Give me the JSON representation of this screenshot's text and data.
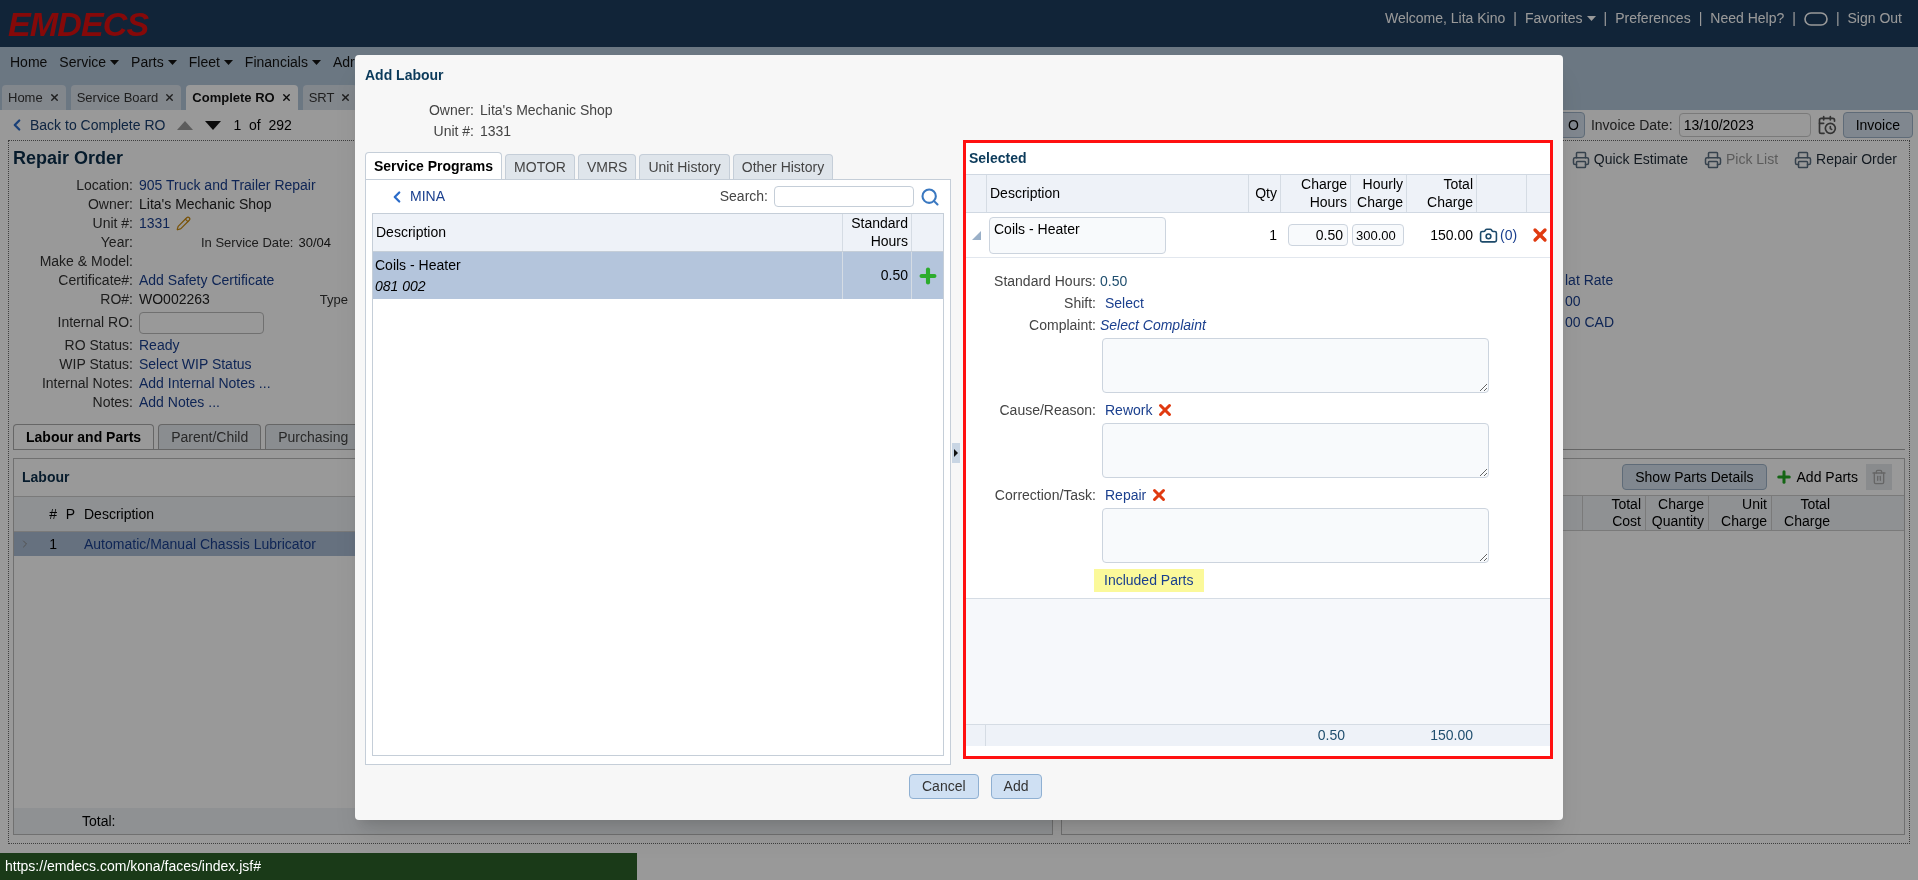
{
  "header": {
    "logo": "EMDECS",
    "items": [
      {
        "kind": "text",
        "label": "Welcome, Lita Kino"
      },
      {
        "kind": "sep",
        "label": "|"
      },
      {
        "kind": "menu",
        "label": "Favorites"
      },
      {
        "kind": "sep",
        "label": "|"
      },
      {
        "kind": "link",
        "label": "Preferences"
      },
      {
        "kind": "sep",
        "label": "|"
      },
      {
        "kind": "link",
        "label": "Need Help?"
      },
      {
        "kind": "sep",
        "label": "|"
      },
      {
        "kind": "chat"
      },
      {
        "kind": "sep",
        "label": "|"
      },
      {
        "kind": "link",
        "label": "Sign Out"
      }
    ]
  },
  "nav": [
    {
      "label": "Home",
      "dropdown": false
    },
    {
      "label": "Service",
      "dropdown": true
    },
    {
      "label": "Parts",
      "dropdown": true
    },
    {
      "label": "Fleet",
      "dropdown": true
    },
    {
      "label": "Financials",
      "dropdown": true
    },
    {
      "label": "Adr",
      "dropdown": false
    }
  ],
  "tabs": [
    {
      "label": "Home",
      "selected": false
    },
    {
      "label": "Service Board",
      "selected": false
    },
    {
      "label": "Complete RO",
      "selected": true
    },
    {
      "label": "SRT",
      "selected": false
    }
  ],
  "toolbar": {
    "back": "Back to Complete RO",
    "pager": "1  of  292",
    "cut_button": "O",
    "invoice_date_label": "Invoice Date:",
    "invoice_date": "13/10/2023",
    "invoice_button": "Invoice"
  },
  "repair_order": {
    "title": "Repair Order",
    "fields": [
      {
        "label": "Location:",
        "value": "905 Truck and Trailer Repair",
        "kind": "link"
      },
      {
        "label": "Owner:",
        "value": "Lita's Mechanic Shop",
        "kind": "text"
      },
      {
        "label": "Unit #:",
        "value": "1331",
        "kind": "editable"
      },
      {
        "label": "Year:",
        "kind": "blank",
        "extra": {
          "label": "In Service Date:",
          "value": "30/04"
        }
      },
      {
        "label": "Make & Model:",
        "kind": "blank"
      },
      {
        "label": "Certificate#:",
        "value": "Add Safety Certificate",
        "kind": "link"
      },
      {
        "label": "RO#:",
        "value": "WO002263",
        "kind": "text",
        "extra": {
          "label": "Type"
        }
      },
      {
        "label": "Internal RO:",
        "kind": "input"
      },
      {
        "label": "RO Status:",
        "value": "Ready",
        "kind": "link"
      },
      {
        "label": "WIP Status:",
        "value": "Select WIP Status",
        "kind": "link"
      },
      {
        "label": "Internal Notes:",
        "value": "Add Internal Notes ...",
        "kind": "link"
      },
      {
        "label": "Notes:",
        "value": "Add Notes ...",
        "kind": "link"
      }
    ],
    "print_links": [
      {
        "label": "Quick Estimate",
        "disabled": false
      },
      {
        "label": "Pick List",
        "disabled": true
      },
      {
        "label": "Repair Order",
        "disabled": false
      }
    ],
    "rate_info": [
      "lat Rate",
      "00",
      "00 CAD"
    ]
  },
  "lower_tabs": [
    {
      "label": "Labour and Parts",
      "selected": true
    },
    {
      "label": "Parent/Child",
      "selected": false
    },
    {
      "label": "Purchasing",
      "selected": false
    }
  ],
  "labour": {
    "title": "Labour",
    "columns": [
      "#",
      "P",
      "Description"
    ],
    "rows": [
      {
        "number": "1",
        "description": "Automatic/Manual Chassis Lubricator",
        "selected": true
      }
    ],
    "total_label": "Total:"
  },
  "parts": {
    "show_details": "Show Parts Details",
    "add_parts": "Add Parts",
    "columns": [
      "Total Cost",
      "Charge Quantity",
      "Unit Charge",
      "Total Charge"
    ]
  },
  "status_bar": "https://emdecs.com/kona/faces/index.jsf#",
  "dialog": {
    "title": "Add Labour",
    "owner_label": "Owner:",
    "owner": "Lita's Mechanic Shop",
    "unit_label": "Unit #:",
    "unit": "1331",
    "tabs": [
      {
        "label": "Service Programs",
        "selected": true
      },
      {
        "label": "MOTOR",
        "selected": false
      },
      {
        "label": "VMRS",
        "selected": false
      },
      {
        "label": "Unit History",
        "selected": false
      },
      {
        "label": "Other History",
        "selected": false
      }
    ],
    "breadcrumb": "MINA",
    "search_label": "Search:",
    "columns": [
      "Description",
      "Standard Hours"
    ],
    "rows": [
      {
        "description": "Coils - Heater",
        "code": "081 002",
        "hours": "0.50",
        "selected": true
      }
    ],
    "selected": {
      "title": "Selected",
      "columns": [
        "Description",
        "Qty",
        "Charge Hours",
        "Hourly Charge",
        "Total Charge"
      ],
      "rows": [
        {
          "description": "Coils - Heater",
          "qty": "1",
          "charge_hours": "0.50",
          "hourly_charge": "300.00",
          "total_charge": "150.00",
          "attachments": "(0)",
          "expanded": true
        }
      ],
      "details": [
        {
          "label": "Standard Hours:",
          "value": "0.50",
          "kind": "plain",
          "removable": false,
          "notes": false
        },
        {
          "label": "Shift:",
          "value": "Select",
          "kind": "link",
          "removable": false,
          "notes": false
        },
        {
          "label": "Complaint:",
          "value": "Select Complaint",
          "kind": "italic",
          "removable": false,
          "notes": true
        },
        {
          "label": "Cause/Reason:",
          "value": "Rework",
          "kind": "link",
          "removable": true,
          "notes": true
        },
        {
          "label": "Correction/Task:",
          "value": "Repair",
          "kind": "link",
          "removable": true,
          "notes": true
        }
      ],
      "included_parts": "Included Parts",
      "total_hours": "0.50",
      "total_charge": "150.00"
    },
    "buttons": [
      "Cancel",
      "Add"
    ]
  }
}
